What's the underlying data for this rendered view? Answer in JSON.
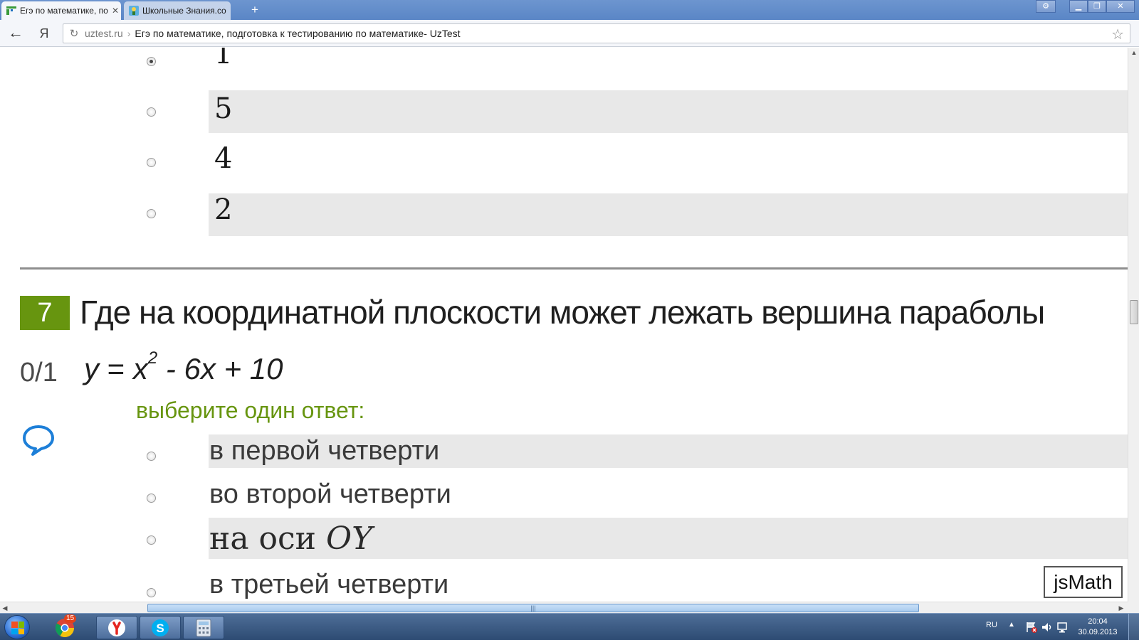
{
  "browser": {
    "tabs": [
      {
        "title": "Егэ по математике, по",
        "active": true
      },
      {
        "title": "Школьные Знания.co",
        "active": false
      }
    ],
    "address": {
      "domain": "uztest.ru",
      "separator": "›",
      "page_title": "Егэ по математике, подготовка к тестированию по математике- UzTest"
    },
    "icons": {
      "back": "back-arrow-icon",
      "yandex": "yandex-icon",
      "reload": "reload-icon",
      "star": "star-icon"
    },
    "yandex_label": "Я"
  },
  "question6": {
    "options": [
      {
        "label": "1",
        "selected": true
      },
      {
        "label": "5",
        "selected": false
      },
      {
        "label": "4",
        "selected": false
      },
      {
        "label": "2",
        "selected": false
      }
    ]
  },
  "question7": {
    "number": "7",
    "text": "Где на координатной плоскости может лежать вершина параболы",
    "formula": {
      "lhs": "y",
      "eq": " = ",
      "base": "x",
      "exp": "2",
      "rest": " - 6x + 10"
    },
    "score": "0/1",
    "prompt": "выберите один ответ:",
    "options": [
      {
        "label": "в первой четверти"
      },
      {
        "label": "во второй четверти"
      },
      {
        "label_prefix": "на оси ",
        "label_math": "OY"
      },
      {
        "label": "в третьей четверти"
      }
    ],
    "accent_color": "#67950f"
  },
  "jsmath": {
    "label": "jsMath"
  },
  "taskbar": {
    "badge": "15",
    "tray": {
      "lang": "RU",
      "time": "20:04",
      "date": "30.09.2013"
    }
  }
}
